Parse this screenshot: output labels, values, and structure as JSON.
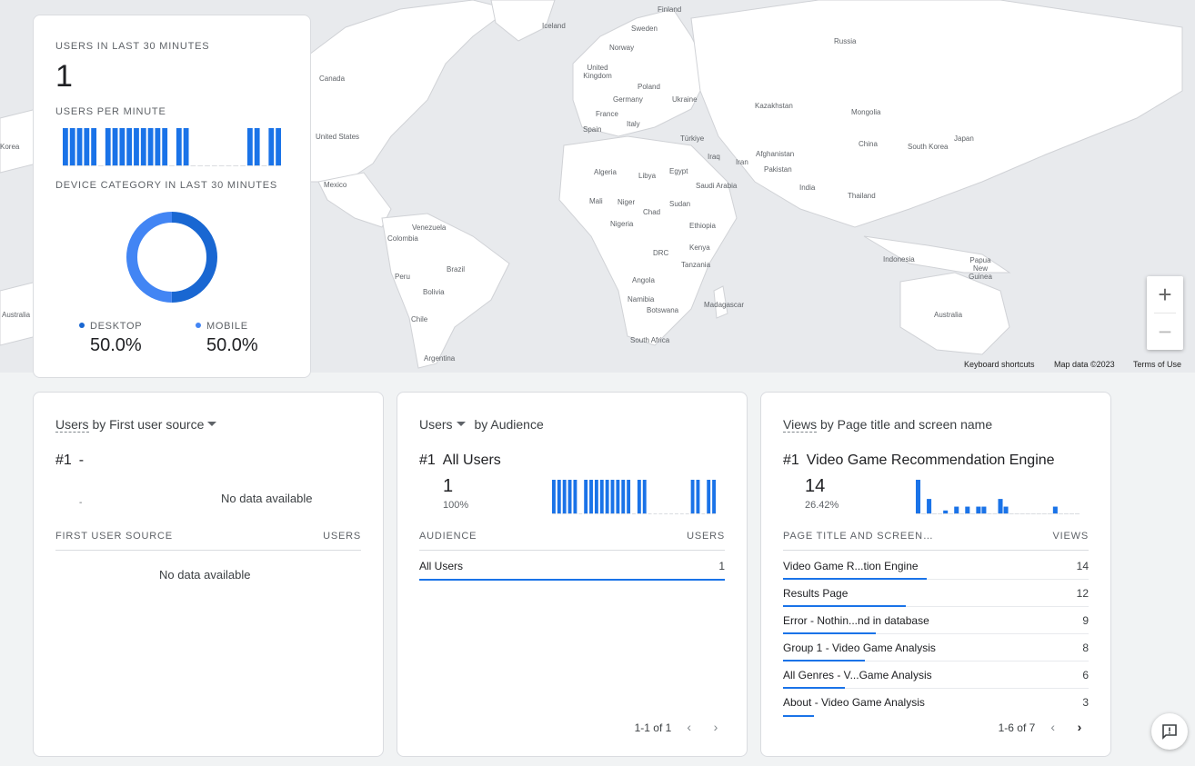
{
  "map": {
    "labels": [
      {
        "text": "Finland",
        "cls": "l1"
      },
      {
        "text": "Sweden",
        "cls": "l2"
      },
      {
        "text": "Iceland",
        "cls": "l3"
      },
      {
        "text": "Norway",
        "cls": "l4"
      },
      {
        "text": "Russia",
        "cls": "l5"
      },
      {
        "text": "United Kingdom",
        "cls": "l6"
      },
      {
        "text": "Poland",
        "cls": "l7"
      },
      {
        "text": "Germany",
        "cls": "l8"
      },
      {
        "text": "Ukraine",
        "cls": "l9"
      },
      {
        "text": "Kazakhstan",
        "cls": "l10"
      },
      {
        "text": "Mongolia",
        "cls": "l11"
      },
      {
        "text": "France",
        "cls": "l12"
      },
      {
        "text": "Italy",
        "cls": "l13"
      },
      {
        "text": "Spain",
        "cls": "l14"
      },
      {
        "text": "Türkiye",
        "cls": "l15"
      },
      {
        "text": "China",
        "cls": "l16"
      },
      {
        "text": "South Korea",
        "cls": "l17"
      },
      {
        "text": "Japan",
        "cls": "l18"
      },
      {
        "text": "Canada",
        "cls": "l19"
      },
      {
        "text": "United States",
        "cls": "l20"
      },
      {
        "text": "Iraq",
        "cls": "l21"
      },
      {
        "text": "Iran",
        "cls": "l22"
      },
      {
        "text": "Afghanistan",
        "cls": "l23"
      },
      {
        "text": "Pakistan",
        "cls": "l24"
      },
      {
        "text": "Algeria",
        "cls": "l25"
      },
      {
        "text": "Libya",
        "cls": "l26"
      },
      {
        "text": "Egypt",
        "cls": "l27"
      },
      {
        "text": "Saudi Arabia",
        "cls": "l28"
      },
      {
        "text": "India",
        "cls": "l29"
      },
      {
        "text": "Mexico",
        "cls": "l30"
      },
      {
        "text": "Thailand",
        "cls": "l31"
      },
      {
        "text": "Mali",
        "cls": "l32"
      },
      {
        "text": "Niger",
        "cls": "l33"
      },
      {
        "text": "Chad",
        "cls": "l34"
      },
      {
        "text": "Sudan",
        "cls": "l35"
      },
      {
        "text": "Venezuela",
        "cls": "l36"
      },
      {
        "text": "Colombia",
        "cls": "l37"
      },
      {
        "text": "Nigeria",
        "cls": "l38"
      },
      {
        "text": "Ethiopia",
        "cls": "l39"
      },
      {
        "text": "Kenya",
        "cls": "l40"
      },
      {
        "text": "DRC",
        "cls": "l41"
      },
      {
        "text": "Brazil",
        "cls": "l42"
      },
      {
        "text": "Indonesia",
        "cls": "l43"
      },
      {
        "text": "Papua New Guinea",
        "cls": "l44"
      },
      {
        "text": "Tanzania",
        "cls": "l45"
      },
      {
        "text": "Peru",
        "cls": "l46"
      },
      {
        "text": "Angola",
        "cls": "l47"
      },
      {
        "text": "Bolivia",
        "cls": "l48"
      },
      {
        "text": "Namibia",
        "cls": "l49"
      },
      {
        "text": "Madagascar",
        "cls": "l50"
      },
      {
        "text": "Botswana",
        "cls": "l51"
      },
      {
        "text": "Australia",
        "cls": "l52"
      },
      {
        "text": "Chile",
        "cls": "l53"
      },
      {
        "text": "South Africa",
        "cls": "l54"
      },
      {
        "text": "Argentina",
        "cls": "l55"
      },
      {
        "text": "Korea",
        "cls": "l56"
      },
      {
        "text": "Australia",
        "cls": "l57"
      }
    ],
    "zoom_in": "+",
    "zoom_out": "−",
    "keyboard_shortcuts": "Keyboard shortcuts",
    "map_data": "Map data ©2023",
    "terms": "Terms of Use"
  },
  "realtime": {
    "users_title": "USERS IN LAST 30 MINUTES",
    "users_count": "1",
    "per_minute_title": "USERS PER MINUTE",
    "per_minute_values": [
      1,
      1,
      1,
      1,
      1,
      0,
      1,
      1,
      1,
      1,
      1,
      1,
      1,
      1,
      1,
      0,
      1,
      1,
      0,
      0,
      0,
      0,
      0,
      0,
      0,
      0,
      1,
      1,
      0,
      1,
      1
    ],
    "device_title": "DEVICE CATEGORY IN LAST 30 MINUTES",
    "devices": [
      {
        "name": "DESKTOP",
        "value": "50.0%",
        "share": 0.5,
        "color": "#1967d2"
      },
      {
        "name": "MOBILE",
        "value": "50.0%",
        "share": 0.5,
        "color": "#4285f4"
      }
    ]
  },
  "source_card": {
    "metric": "Users",
    "dimension": "by First user source",
    "rank": "#1",
    "top_item": "-",
    "top_value": "-",
    "no_data_top": "No data available",
    "col_dim": "FIRST USER SOURCE",
    "col_metric": "USERS",
    "no_data_table": "No data available"
  },
  "audience_card": {
    "metric": "Users",
    "dimension": "by Audience",
    "rank": "#1",
    "top_item": "All Users",
    "top_value": "1",
    "top_pct": "100%",
    "spark": [
      1,
      1,
      1,
      1,
      1,
      0,
      1,
      1,
      1,
      1,
      1,
      1,
      1,
      1,
      1,
      0,
      1,
      1,
      0,
      0,
      0,
      0,
      0,
      0,
      0,
      0,
      1,
      1,
      0,
      1,
      1
    ],
    "col_dim": "AUDIENCE",
    "col_metric": "USERS",
    "rows": [
      {
        "label": "All Users",
        "value": "1",
        "share": 1.0
      }
    ],
    "pager": "1-1 of 1"
  },
  "views_card": {
    "metric": "Views",
    "dimension": "by Page title and screen name",
    "rank": "#1",
    "top_item": "Video Game Recommendation Engine",
    "top_value": "14",
    "top_pct": "26.42%",
    "spark": [
      9,
      0,
      4,
      0,
      0,
      1,
      0,
      2,
      0,
      2,
      0,
      2,
      2,
      0,
      0,
      4,
      2,
      0,
      0,
      0,
      0,
      0,
      0,
      0,
      0,
      2,
      0,
      0,
      0,
      0
    ],
    "col_dim": "PAGE TITLE AND SCREEN…",
    "col_metric": "VIEWS",
    "rows": [
      {
        "label": "Video Game R...tion Engine",
        "value": "14",
        "share": 1.0
      },
      {
        "label": "Results Page",
        "value": "12",
        "share": 0.857
      },
      {
        "label": "Error - Nothin...nd in database",
        "value": "9",
        "share": 0.643
      },
      {
        "label": "Group 1 - Video Game Analysis",
        "value": "8",
        "share": 0.571
      },
      {
        "label": "All Genres - V...Game Analysis",
        "value": "6",
        "share": 0.429
      },
      {
        "label": "About - Video Game Analysis",
        "value": "3",
        "share": 0.214
      }
    ],
    "pager": "1-6 of 7"
  },
  "pager_prev": "‹",
  "pager_next": "›"
}
